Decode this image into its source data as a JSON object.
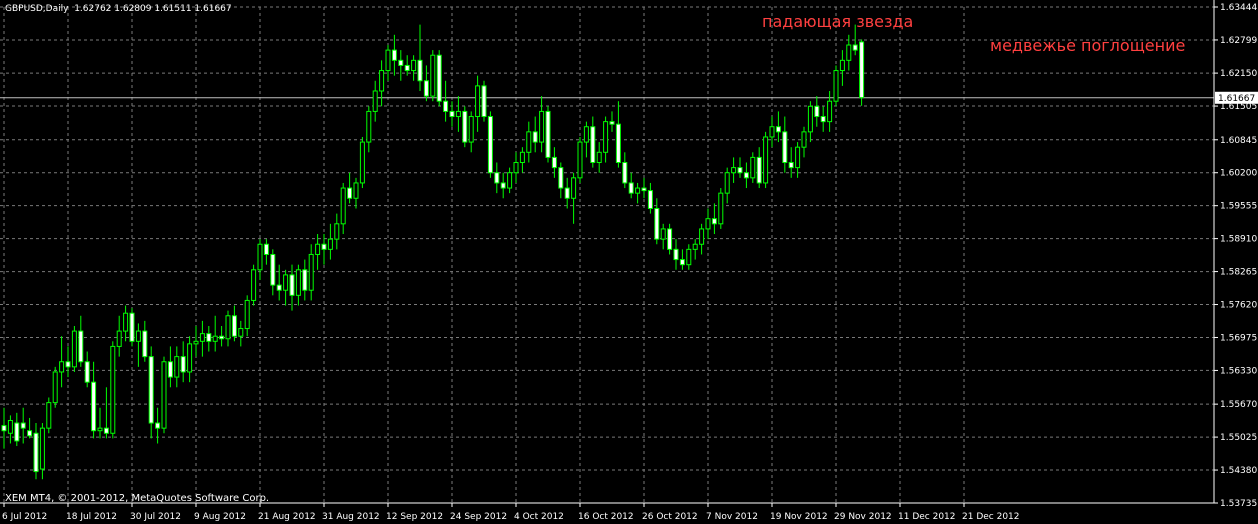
{
  "header": {
    "symbol": "GBPUSD,Daily",
    "ohlc": "1.62762 1.62809 1.61511 1.61667"
  },
  "copyright": "XEM MT4, © 2001-2012, MetaQuotes Software Corp.",
  "annotations": {
    "shooting_star": "падающая звезда",
    "bearish_engulfing": "медвежье поглощение"
  },
  "colors": {
    "background": "#000000",
    "grid": "#7a7a7a",
    "candle": "#00ff00",
    "bull_body": "#000000",
    "bear_body": "#ffffff",
    "axis_text": "#ffffff",
    "annotation": "#ff4040",
    "price_line": "#c0c0c0"
  },
  "chart_data": {
    "type": "candlestick",
    "symbol": "GBPUSD",
    "timeframe": "Daily",
    "ylim": [
      1.53735,
      1.63444
    ],
    "yticks": [
      "1.63444",
      "1.62799",
      "1.62150",
      "1.61505",
      "1.60845",
      "1.60200",
      "1.59555",
      "1.58910",
      "1.58265",
      "1.57620",
      "1.56975",
      "1.56330",
      "1.55670",
      "1.55025",
      "1.54380",
      "1.53735"
    ],
    "xticks": [
      "6 Jul 2012",
      "18 Jul 2012",
      "30 Jul 2012",
      "9 Aug 2012",
      "21 Aug 2012",
      "31 Aug 2012",
      "12 Sep 2012",
      "24 Sep 2012",
      "4 Oct 2012",
      "16 Oct 2012",
      "26 Oct 2012",
      "7 Nov 2012",
      "19 Nov 2012",
      "29 Nov 2012",
      "11 Dec 2012",
      "21 Dec 2012"
    ],
    "current_price": "1.61667",
    "grid": true,
    "candles": [
      {
        "o": 1.5525,
        "h": 1.556,
        "l": 1.548,
        "c": 1.5515
      },
      {
        "o": 1.551,
        "h": 1.5545,
        "l": 1.549,
        "c": 1.5535
      },
      {
        "o": 1.553,
        "h": 1.555,
        "l": 1.5485,
        "c": 1.5495
      },
      {
        "o": 1.553,
        "h": 1.556,
        "l": 1.549,
        "c": 1.552
      },
      {
        "o": 1.5515,
        "h": 1.554,
        "l": 1.55,
        "c": 1.5505
      },
      {
        "o": 1.551,
        "h": 1.553,
        "l": 1.542,
        "c": 1.5435
      },
      {
        "o": 1.544,
        "h": 1.553,
        "l": 1.542,
        "c": 1.552
      },
      {
        "o": 1.552,
        "h": 1.558,
        "l": 1.551,
        "c": 1.557
      },
      {
        "o": 1.557,
        "h": 1.564,
        "l": 1.556,
        "c": 1.563
      },
      {
        "o": 1.563,
        "h": 1.57,
        "l": 1.56,
        "c": 1.565
      },
      {
        "o": 1.565,
        "h": 1.568,
        "l": 1.562,
        "c": 1.564
      },
      {
        "o": 1.564,
        "h": 1.572,
        "l": 1.563,
        "c": 1.571
      },
      {
        "o": 1.571,
        "h": 1.574,
        "l": 1.564,
        "c": 1.565
      },
      {
        "o": 1.565,
        "h": 1.567,
        "l": 1.56,
        "c": 1.561
      },
      {
        "o": 1.561,
        "h": 1.565,
        "l": 1.55,
        "c": 1.5515
      },
      {
        "o": 1.5515,
        "h": 1.556,
        "l": 1.55,
        "c": 1.552
      },
      {
        "o": 1.552,
        "h": 1.56,
        "l": 1.55,
        "c": 1.551
      },
      {
        "o": 1.551,
        "h": 1.569,
        "l": 1.55,
        "c": 1.568
      },
      {
        "o": 1.568,
        "h": 1.574,
        "l": 1.566,
        "c": 1.571
      },
      {
        "o": 1.571,
        "h": 1.576,
        "l": 1.569,
        "c": 1.5745
      },
      {
        "o": 1.5745,
        "h": 1.5755,
        "l": 1.568,
        "c": 1.569
      },
      {
        "o": 1.569,
        "h": 1.5725,
        "l": 1.564,
        "c": 1.571
      },
      {
        "o": 1.571,
        "h": 1.573,
        "l": 1.565,
        "c": 1.566
      },
      {
        "o": 1.566,
        "h": 1.568,
        "l": 1.55,
        "c": 1.553
      },
      {
        "o": 1.553,
        "h": 1.556,
        "l": 1.549,
        "c": 1.552
      },
      {
        "o": 1.552,
        "h": 1.566,
        "l": 1.551,
        "c": 1.565
      },
      {
        "o": 1.565,
        "h": 1.568,
        "l": 1.56,
        "c": 1.562
      },
      {
        "o": 1.562,
        "h": 1.568,
        "l": 1.56,
        "c": 1.566
      },
      {
        "o": 1.566,
        "h": 1.569,
        "l": 1.561,
        "c": 1.563
      },
      {
        "o": 1.563,
        "h": 1.57,
        "l": 1.561,
        "c": 1.5685
      },
      {
        "o": 1.5685,
        "h": 1.572,
        "l": 1.566,
        "c": 1.569
      },
      {
        "o": 1.569,
        "h": 1.573,
        "l": 1.566,
        "c": 1.5705
      },
      {
        "o": 1.5705,
        "h": 1.572,
        "l": 1.567,
        "c": 1.569
      },
      {
        "o": 1.569,
        "h": 1.574,
        "l": 1.567,
        "c": 1.57
      },
      {
        "o": 1.57,
        "h": 1.572,
        "l": 1.568,
        "c": 1.5695
      },
      {
        "o": 1.5695,
        "h": 1.575,
        "l": 1.568,
        "c": 1.574
      },
      {
        "o": 1.574,
        "h": 1.576,
        "l": 1.569,
        "c": 1.57
      },
      {
        "o": 1.57,
        "h": 1.573,
        "l": 1.568,
        "c": 1.5715
      },
      {
        "o": 1.5715,
        "h": 1.578,
        "l": 1.57,
        "c": 1.577
      },
      {
        "o": 1.577,
        "h": 1.584,
        "l": 1.576,
        "c": 1.583
      },
      {
        "o": 1.583,
        "h": 1.589,
        "l": 1.581,
        "c": 1.588
      },
      {
        "o": 1.588,
        "h": 1.589,
        "l": 1.584,
        "c": 1.586
      },
      {
        "o": 1.586,
        "h": 1.587,
        "l": 1.578,
        "c": 1.58
      },
      {
        "o": 1.58,
        "h": 1.584,
        "l": 1.577,
        "c": 1.579
      },
      {
        "o": 1.579,
        "h": 1.583,
        "l": 1.576,
        "c": 1.582
      },
      {
        "o": 1.582,
        "h": 1.584,
        "l": 1.575,
        "c": 1.578
      },
      {
        "o": 1.578,
        "h": 1.584,
        "l": 1.576,
        "c": 1.583
      },
      {
        "o": 1.583,
        "h": 1.585,
        "l": 1.577,
        "c": 1.579
      },
      {
        "o": 1.579,
        "h": 1.588,
        "l": 1.577,
        "c": 1.586
      },
      {
        "o": 1.586,
        "h": 1.59,
        "l": 1.583,
        "c": 1.588
      },
      {
        "o": 1.588,
        "h": 1.59,
        "l": 1.584,
        "c": 1.587
      },
      {
        "o": 1.587,
        "h": 1.592,
        "l": 1.585,
        "c": 1.589
      },
      {
        "o": 1.589,
        "h": 1.594,
        "l": 1.587,
        "c": 1.592
      },
      {
        "o": 1.592,
        "h": 1.6,
        "l": 1.59,
        "c": 1.599
      },
      {
        "o": 1.599,
        "h": 1.602,
        "l": 1.596,
        "c": 1.597
      },
      {
        "o": 1.597,
        "h": 1.601,
        "l": 1.595,
        "c": 1.6
      },
      {
        "o": 1.6,
        "h": 1.609,
        "l": 1.599,
        "c": 1.608
      },
      {
        "o": 1.608,
        "h": 1.615,
        "l": 1.606,
        "c": 1.614
      },
      {
        "o": 1.614,
        "h": 1.62,
        "l": 1.612,
        "c": 1.618
      },
      {
        "o": 1.618,
        "h": 1.624,
        "l": 1.615,
        "c": 1.622
      },
      {
        "o": 1.622,
        "h": 1.627,
        "l": 1.62,
        "c": 1.626
      },
      {
        "o": 1.626,
        "h": 1.629,
        "l": 1.621,
        "c": 1.624
      },
      {
        "o": 1.624,
        "h": 1.626,
        "l": 1.62,
        "c": 1.623
      },
      {
        "o": 1.623,
        "h": 1.625,
        "l": 1.621,
        "c": 1.622
      },
      {
        "o": 1.622,
        "h": 1.625,
        "l": 1.62,
        "c": 1.624
      },
      {
        "o": 1.624,
        "h": 1.631,
        "l": 1.618,
        "c": 1.62
      },
      {
        "o": 1.62,
        "h": 1.623,
        "l": 1.616,
        "c": 1.617
      },
      {
        "o": 1.617,
        "h": 1.626,
        "l": 1.616,
        "c": 1.625
      },
      {
        "o": 1.625,
        "h": 1.626,
        "l": 1.615,
        "c": 1.616
      },
      {
        "o": 1.616,
        "h": 1.62,
        "l": 1.612,
        "c": 1.614
      },
      {
        "o": 1.614,
        "h": 1.616,
        "l": 1.611,
        "c": 1.613
      },
      {
        "o": 1.613,
        "h": 1.617,
        "l": 1.61,
        "c": 1.614
      },
      {
        "o": 1.614,
        "h": 1.615,
        "l": 1.607,
        "c": 1.608
      },
      {
        "o": 1.608,
        "h": 1.614,
        "l": 1.606,
        "c": 1.613
      },
      {
        "o": 1.613,
        "h": 1.621,
        "l": 1.61,
        "c": 1.619
      },
      {
        "o": 1.619,
        "h": 1.62,
        "l": 1.612,
        "c": 1.613
      },
      {
        "o": 1.613,
        "h": 1.614,
        "l": 1.601,
        "c": 1.602
      },
      {
        "o": 1.602,
        "h": 1.604,
        "l": 1.598,
        "c": 1.6
      },
      {
        "o": 1.6,
        "h": 1.602,
        "l": 1.597,
        "c": 1.599
      },
      {
        "o": 1.599,
        "h": 1.603,
        "l": 1.598,
        "c": 1.602
      },
      {
        "o": 1.602,
        "h": 1.606,
        "l": 1.6,
        "c": 1.604
      },
      {
        "o": 1.604,
        "h": 1.607,
        "l": 1.602,
        "c": 1.606
      },
      {
        "o": 1.606,
        "h": 1.612,
        "l": 1.604,
        "c": 1.61
      },
      {
        "o": 1.61,
        "h": 1.613,
        "l": 1.606,
        "c": 1.608
      },
      {
        "o": 1.608,
        "h": 1.617,
        "l": 1.606,
        "c": 1.614
      },
      {
        "o": 1.614,
        "h": 1.615,
        "l": 1.604,
        "c": 1.605
      },
      {
        "o": 1.605,
        "h": 1.607,
        "l": 1.601,
        "c": 1.603
      },
      {
        "o": 1.603,
        "h": 1.604,
        "l": 1.597,
        "c": 1.599
      },
      {
        "o": 1.599,
        "h": 1.601,
        "l": 1.595,
        "c": 1.597
      },
      {
        "o": 1.597,
        "h": 1.602,
        "l": 1.592,
        "c": 1.601
      },
      {
        "o": 1.601,
        "h": 1.609,
        "l": 1.6,
        "c": 1.608
      },
      {
        "o": 1.608,
        "h": 1.612,
        "l": 1.605,
        "c": 1.611
      },
      {
        "o": 1.611,
        "h": 1.613,
        "l": 1.603,
        "c": 1.604
      },
      {
        "o": 1.604,
        "h": 1.608,
        "l": 1.602,
        "c": 1.606
      },
      {
        "o": 1.606,
        "h": 1.613,
        "l": 1.604,
        "c": 1.612
      },
      {
        "o": 1.612,
        "h": 1.614,
        "l": 1.61,
        "c": 1.6115
      },
      {
        "o": 1.6115,
        "h": 1.616,
        "l": 1.603,
        "c": 1.604
      },
      {
        "o": 1.604,
        "h": 1.606,
        "l": 1.599,
        "c": 1.6
      },
      {
        "o": 1.6,
        "h": 1.602,
        "l": 1.597,
        "c": 1.598
      },
      {
        "o": 1.598,
        "h": 1.6,
        "l": 1.596,
        "c": 1.599
      },
      {
        "o": 1.599,
        "h": 1.601,
        "l": 1.597,
        "c": 1.5985
      },
      {
        "o": 1.5985,
        "h": 1.6,
        "l": 1.594,
        "c": 1.595
      },
      {
        "o": 1.595,
        "h": 1.597,
        "l": 1.588,
        "c": 1.589
      },
      {
        "o": 1.589,
        "h": 1.592,
        "l": 1.587,
        "c": 1.591
      },
      {
        "o": 1.591,
        "h": 1.592,
        "l": 1.586,
        "c": 1.587
      },
      {
        "o": 1.587,
        "h": 1.589,
        "l": 1.583,
        "c": 1.585
      },
      {
        "o": 1.585,
        "h": 1.587,
        "l": 1.583,
        "c": 1.584
      },
      {
        "o": 1.584,
        "h": 1.588,
        "l": 1.583,
        "c": 1.587
      },
      {
        "o": 1.587,
        "h": 1.589,
        "l": 1.585,
        "c": 1.588
      },
      {
        "o": 1.588,
        "h": 1.592,
        "l": 1.586,
        "c": 1.591
      },
      {
        "o": 1.591,
        "h": 1.595,
        "l": 1.589,
        "c": 1.593
      },
      {
        "o": 1.593,
        "h": 1.596,
        "l": 1.59,
        "c": 1.592
      },
      {
        "o": 1.592,
        "h": 1.599,
        "l": 1.591,
        "c": 1.598
      },
      {
        "o": 1.598,
        "h": 1.603,
        "l": 1.596,
        "c": 1.602
      },
      {
        "o": 1.602,
        "h": 1.605,
        "l": 1.6,
        "c": 1.603
      },
      {
        "o": 1.603,
        "h": 1.605,
        "l": 1.601,
        "c": 1.602
      },
      {
        "o": 1.602,
        "h": 1.604,
        "l": 1.599,
        "c": 1.601
      },
      {
        "o": 1.601,
        "h": 1.606,
        "l": 1.6,
        "c": 1.605
      },
      {
        "o": 1.605,
        "h": 1.607,
        "l": 1.599,
        "c": 1.6
      },
      {
        "o": 1.6,
        "h": 1.61,
        "l": 1.599,
        "c": 1.609
      },
      {
        "o": 1.609,
        "h": 1.613,
        "l": 1.607,
        "c": 1.611
      },
      {
        "o": 1.611,
        "h": 1.614,
        "l": 1.608,
        "c": 1.61
      },
      {
        "o": 1.61,
        "h": 1.613,
        "l": 1.602,
        "c": 1.604
      },
      {
        "o": 1.604,
        "h": 1.607,
        "l": 1.601,
        "c": 1.603
      },
      {
        "o": 1.603,
        "h": 1.608,
        "l": 1.601,
        "c": 1.607
      },
      {
        "o": 1.607,
        "h": 1.611,
        "l": 1.605,
        "c": 1.61
      },
      {
        "o": 1.61,
        "h": 1.616,
        "l": 1.608,
        "c": 1.615
      },
      {
        "o": 1.615,
        "h": 1.617,
        "l": 1.611,
        "c": 1.613
      },
      {
        "o": 1.613,
        "h": 1.615,
        "l": 1.61,
        "c": 1.612
      },
      {
        "o": 1.612,
        "h": 1.618,
        "l": 1.61,
        "c": 1.616
      },
      {
        "o": 1.616,
        "h": 1.623,
        "l": 1.615,
        "c": 1.622
      },
      {
        "o": 1.622,
        "h": 1.626,
        "l": 1.619,
        "c": 1.624
      },
      {
        "o": 1.624,
        "h": 1.629,
        "l": 1.622,
        "c": 1.627
      },
      {
        "o": 1.627,
        "h": 1.631,
        "l": 1.625,
        "c": 1.626
      },
      {
        "o": 1.6276,
        "h": 1.6281,
        "l": 1.6151,
        "c": 1.6167
      }
    ]
  }
}
